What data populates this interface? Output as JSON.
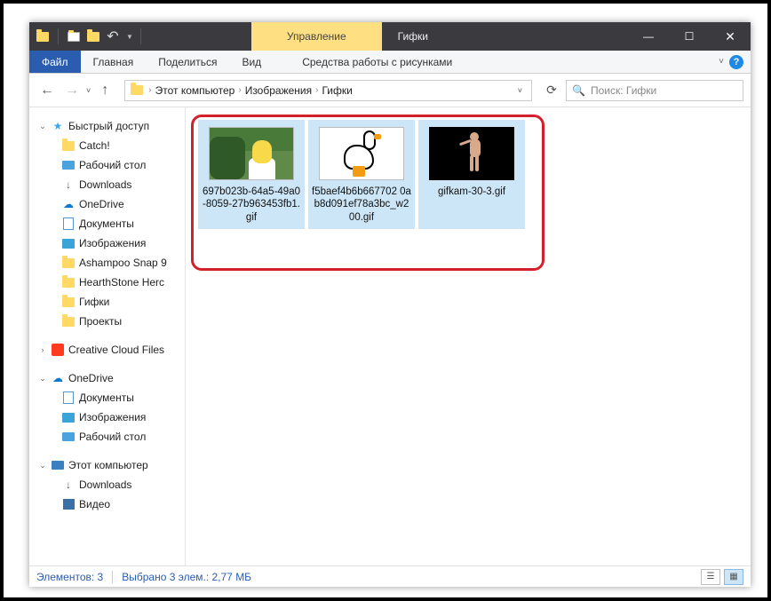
{
  "titlebar": {
    "context_tab": "Управление",
    "folder_name": "Гифки"
  },
  "ribbon": {
    "file": "Файл",
    "tabs": [
      "Главная",
      "Поделиться",
      "Вид"
    ],
    "context": "Средства работы с рисунками"
  },
  "breadcrumb": {
    "segments": [
      "Этот компьютер",
      "Изображения",
      "Гифки"
    ]
  },
  "search": {
    "placeholder": "Поиск: Гифки"
  },
  "sidebar": {
    "quick_access": "Быстрый доступ",
    "qa_items": [
      "Catch!",
      "Рабочий стол",
      "Downloads",
      "OneDrive",
      "Документы",
      "Изображения",
      "Ashampoo Snap 9",
      "HearthStone  Herc",
      "Гифки",
      "Проекты"
    ],
    "creative_cloud": "Creative Cloud Files",
    "onedrive": "OneDrive",
    "od_items": [
      "Документы",
      "Изображения",
      "Рабочий стол"
    ],
    "this_pc": "Этот компьютер",
    "pc_items": [
      "Downloads",
      "Видео"
    ]
  },
  "files": [
    {
      "name": "697b023b-64a5-49a0-8059-27b963453fb1.gif"
    },
    {
      "name": "f5baef4b6b667702 0ab8d091ef78a3bc_w200.gif"
    },
    {
      "name": "gifkam-30-3.gif"
    }
  ],
  "status": {
    "count": "Элементов: 3",
    "selection": "Выбрано 3 элем.: 2,77 МБ"
  }
}
